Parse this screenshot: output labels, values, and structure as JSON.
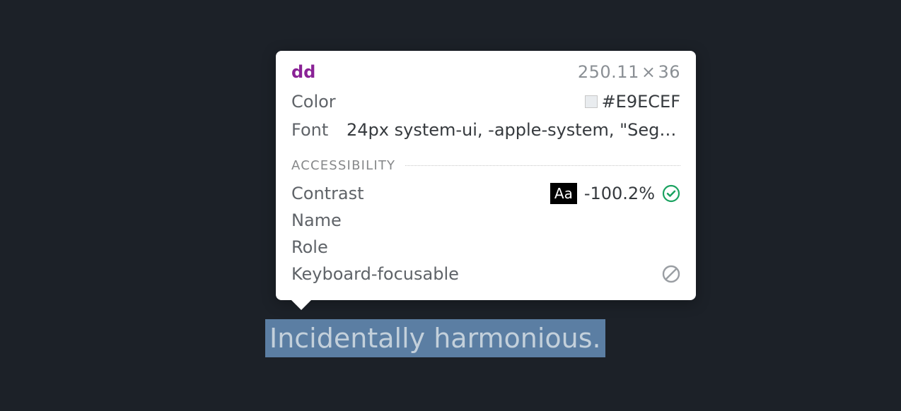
{
  "highlighted": {
    "text": "Incidentally harmonious."
  },
  "tooltip": {
    "tag": "dd",
    "dims": {
      "w": "250.11",
      "x": "×",
      "h": "36"
    },
    "props": {
      "color_label": "Color",
      "color_value": "#E9ECEF",
      "font_label": "Font",
      "font_value": "24px system-ui, -apple-system, \"Segoe…"
    },
    "a11y": {
      "section_title": "Accessibility",
      "contrast_label": "Contrast",
      "contrast_sample": "Aa",
      "contrast_value": "-100.2%",
      "name_label": "Name",
      "role_label": "Role",
      "kf_label": "Keyboard-focusable"
    }
  }
}
